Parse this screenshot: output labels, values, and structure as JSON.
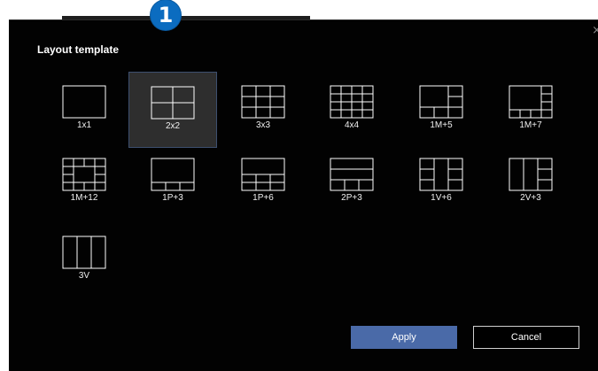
{
  "badge": {
    "label": "1"
  },
  "dialog": {
    "title": "Layout template",
    "close_label": "×"
  },
  "layouts": [
    {
      "label": "1x1",
      "icon": "layout-1x1-icon",
      "selected": false
    },
    {
      "label": "2x2",
      "icon": "layout-2x2-icon",
      "selected": true
    },
    {
      "label": "3x3",
      "icon": "layout-3x3-icon",
      "selected": false
    },
    {
      "label": "4x4",
      "icon": "layout-4x4-icon",
      "selected": false
    },
    {
      "label": "1M+5",
      "icon": "layout-1m5-icon",
      "selected": false
    },
    {
      "label": "1M+7",
      "icon": "layout-1m7-icon",
      "selected": false
    },
    {
      "label": "1M+12",
      "icon": "layout-1m12-icon",
      "selected": false
    },
    {
      "label": "1P+3",
      "icon": "layout-1p3-icon",
      "selected": false
    },
    {
      "label": "1P+6",
      "icon": "layout-1p6-icon",
      "selected": false
    },
    {
      "label": "2P+3",
      "icon": "layout-2p3-icon",
      "selected": false
    },
    {
      "label": "1V+6",
      "icon": "layout-1v6-icon",
      "selected": false
    },
    {
      "label": "2V+3",
      "icon": "layout-2v3-icon",
      "selected": false
    },
    {
      "label": "3V",
      "icon": "layout-3v-icon",
      "selected": false
    }
  ],
  "buttons": {
    "apply_label": "Apply",
    "cancel_label": "Cancel"
  },
  "colors": {
    "dialog_bg": "#020202",
    "selected_tile_bg": "#2e2e2e",
    "apply_bg": "#4a6aa8",
    "badge_bg": "#0b6cc0"
  }
}
